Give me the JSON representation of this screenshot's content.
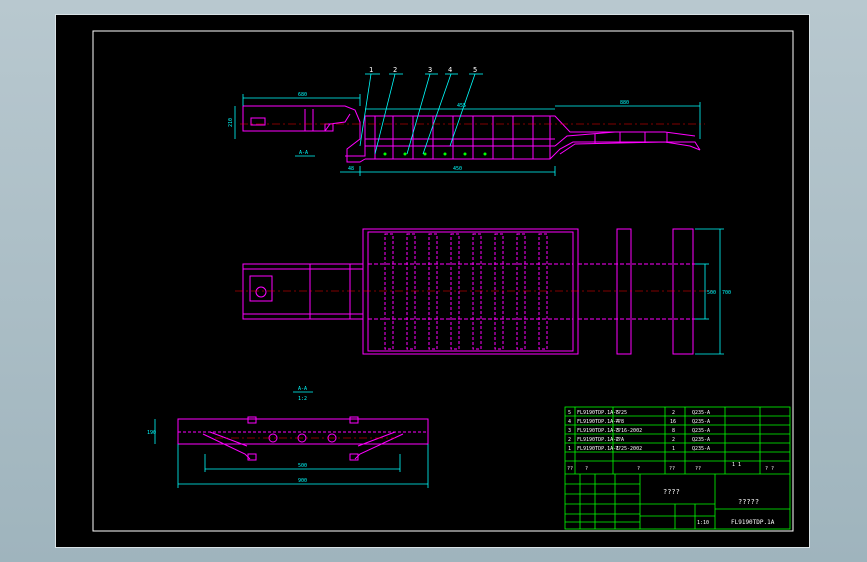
{
  "drawing": {
    "title_cn": "????",
    "title_cn2": "?????",
    "drawing_no": "FL9190TDP.1A",
    "scale": "1:10",
    "sheet_mark": "1 1",
    "section_label": "A-A",
    "section_label2": "A-A",
    "section_scale": "1:2",
    "colors": {
      "sheet": "#000000",
      "frame": "#ffffff",
      "part_lines": "#ff00ff",
      "dimensions": "#00ffff",
      "center_lines": "#ff0000",
      "table": "#00ff00"
    }
  },
  "callouts": [
    "1",
    "2",
    "3",
    "4",
    "5"
  ],
  "parts": [
    {
      "no": "5",
      "code": "FL9190TDP.1A-5",
      "name": "??25",
      "qty": "2",
      "material": "Q235-A"
    },
    {
      "no": "4",
      "code": "FL9190TDP.1A-4",
      "name": "??8",
      "qty": "16",
      "material": "Q235-A"
    },
    {
      "no": "3",
      "code": "FL9190TDP.1A-3",
      "name": "??16-2002",
      "qty": "8",
      "material": "Q235-A"
    },
    {
      "no": "2",
      "code": "FL9190TDP.1A-2",
      "name": "??A",
      "qty": "2",
      "material": "Q235-A"
    },
    {
      "no": "1",
      "code": "FL9190TDP.1A-1",
      "name": "??25-2002",
      "qty": "1",
      "material": "Q235-A"
    }
  ],
  "header_row": {
    "c1": "??",
    "c2": "?",
    "c3": "?",
    "c4": "??",
    "c5": "??",
    "c6": "1 1",
    "c7": "? ?"
  },
  "dims": {
    "top_left_len": "680",
    "top_left_h": "210",
    "top_mid": "455",
    "top_right": "880",
    "top_bottom": "450",
    "top_bottom_left": "48",
    "plan_width": "700",
    "plan_inner": "500",
    "sec_total": "900",
    "sec_inner": "500",
    "sec_h": "190"
  }
}
